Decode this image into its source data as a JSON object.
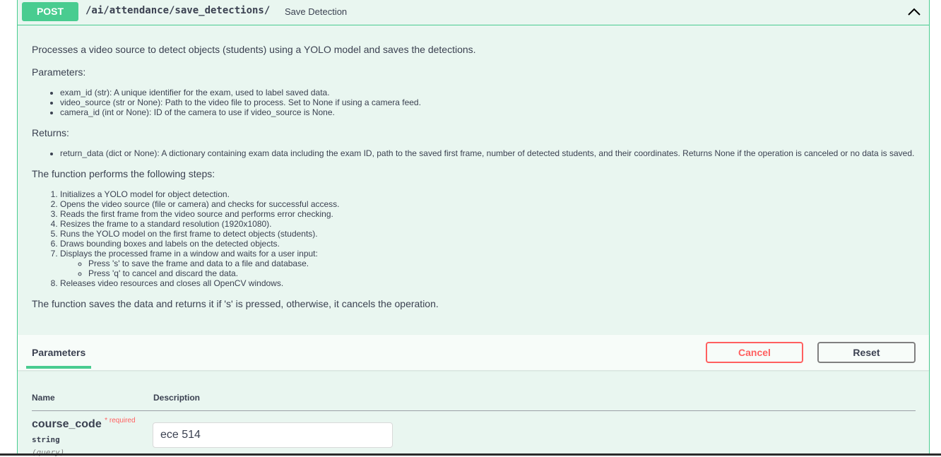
{
  "operation": {
    "method": "POST",
    "path": "/ai/attendance/save_detections/",
    "summary": "Save Detection"
  },
  "description": {
    "intro": "Processes a video source to detect objects (students) using a YOLO model and saves the detections.",
    "parameters_heading": "Parameters:",
    "parameters": [
      "exam_id (str): A unique identifier for the exam, used to label saved data.",
      "video_source (str or None): Path to the video file to process. Set to None if using a camera feed.",
      "camera_id (int or None): ID of the camera to use if video_source is None."
    ],
    "returns_heading": "Returns:",
    "returns": [
      "return_data (dict or None): A dictionary containing exam data including the exam ID, path to the saved first frame, number of detected students, and their coordinates. Returns None if the operation is canceled or no data is saved."
    ],
    "steps_heading": "The function performs the following steps:",
    "steps": [
      "Initializes a YOLO model for object detection.",
      "Opens the video source (file or camera) and checks for successful access.",
      "Reads the first frame from the video source and performs error checking.",
      "Resizes the frame to a standard resolution (1920x1080).",
      "Runs the YOLO model on the first frame to detect objects (students).",
      "Draws bounding boxes and labels on the detected objects.",
      "Displays the processed frame in a window and waits for a user input:",
      "Releases video resources and closes all OpenCV windows."
    ],
    "substeps": [
      "Press 's' to save the frame and data to a file and database.",
      "Press 'q' to cancel and discard the data."
    ],
    "outro": "The function saves the data and returns it if 's' is pressed, otherwise, it cancels the operation."
  },
  "tabs": {
    "parameters_label": "Parameters",
    "cancel_label": "Cancel",
    "reset_label": "Reset"
  },
  "params_table": {
    "name_header": "Name",
    "description_header": "Description",
    "rows": [
      {
        "name": "course_code",
        "required_marker": "*",
        "required_label": "required",
        "type": "string",
        "in": "(query)",
        "value": "ece 514"
      }
    ]
  },
  "colors": {
    "post": "#49cc90",
    "post_bg": "#e9f6f0",
    "cancel": "#ff6060"
  },
  "icons": {
    "collapse": "chevron-up-icon"
  }
}
